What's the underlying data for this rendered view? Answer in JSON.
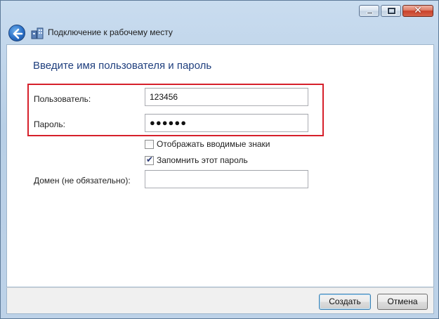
{
  "window": {
    "title": "Подключение к рабочему месту",
    "close_glyph": "✕"
  },
  "form": {
    "heading": "Введите имя пользователя и пароль",
    "username_label": "Пользователь:",
    "username_value": "123456",
    "password_label": "Пароль:",
    "password_mask": "●●●●●●",
    "show_chars_label": "Отображать вводимые знаки",
    "show_chars_checked": false,
    "remember_label": "Запомнить этот пароль",
    "remember_checked": true,
    "checkmark_glyph": "✔",
    "domain_label": "Домен (не обязательно):",
    "domain_value": ""
  },
  "buttons": {
    "create": "Создать",
    "cancel": "Отмена"
  },
  "colors": {
    "highlight_box": "#d6202b",
    "heading": "#1f3f7e"
  }
}
